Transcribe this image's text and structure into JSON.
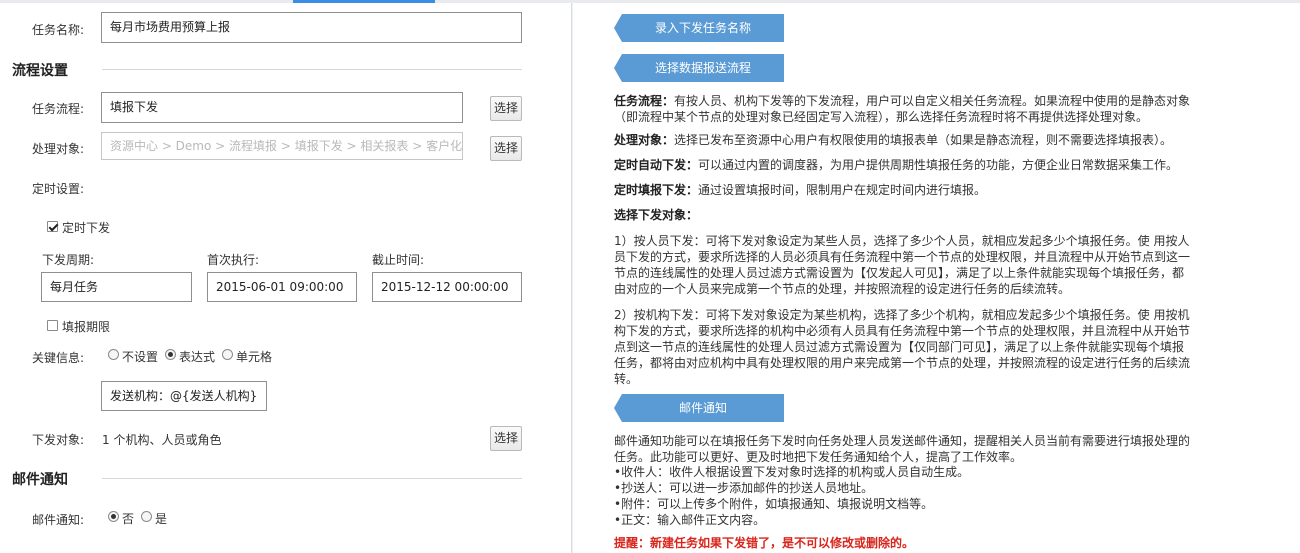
{
  "form": {
    "task_name_label": "任务名称:",
    "task_name_value": "每月市场费用预算上报",
    "section_flow": "流程设置",
    "flow_label": "任务流程:",
    "flow_value": "填报下发",
    "select_label": "选择",
    "target_label": "处理对象:",
    "target_value": "资源中心 > Demo > 流程填报 > 填报下发 > 相关报表 > 客户化de",
    "timer_label": "定时设置:",
    "timer_checkbox": "定时下发",
    "timer_checked": true,
    "period_label": "下发周期:",
    "period_value": "每月任务",
    "first_label": "首次执行:",
    "first_value": "2015-06-01 09:00:00",
    "deadline_label": "截止时间:",
    "deadline_value": "2015-12-12 00:00:00",
    "limit_checkbox": "填报期限",
    "limit_checked": false,
    "key_label": "关键信息:",
    "key_options": [
      "不设置",
      "表达式",
      "单元格"
    ],
    "key_selected": 1,
    "key_expr": "发送机构：@{发送人机构}",
    "dispatch_label": "下发对象:",
    "dispatch_value": "1 个机构、人员或角色",
    "section_mail": "邮件通知",
    "mail_label": "邮件通知:",
    "mail_options": [
      "否",
      "是"
    ],
    "mail_selected": 0
  },
  "help": {
    "tag1": "录入下发任务名称",
    "tag2": "选择数据报送流程",
    "p1_title": "任务流程：",
    "p1_text": "有按人员、机构下发等的下发流程，用户可以自定义相关任务流程。如果流程中使用的是静态对象（即流程中某个节点的处理对象已经固定写入流程），那么选择任务流程时将不再提供选择处理对象。",
    "p2_title": "处理对象：",
    "p2_text": "选择已发布至资源中心用户有权限使用的填报表单（如果是静态流程，则不需要选择填报表）。",
    "p3_title": "定时自动下发：",
    "p3_text": "可以通过内置的调度器，为用户提供周期性填报任务的功能，方便企业日常数据采集工作。",
    "p4_title": "定时填报下发：",
    "p4_text": "通过设置填报时间，限制用户在规定时间内进行填报。",
    "p5_title": "选择下发对象：",
    "p6_text": "1）按人员下发：可将下发对象设定为某些人员，选择了多少个人员，就相应发起多少个填报任务。使 用按人员下发的方式，要求所选择的人员必须具有任务流程中第一个节点的处理权限，并且流程中从开始节点到这一节点的连线属性的处理人员过滤方式需设置为【仅发起人可见】，满足了以上条件就能实现每个填报任务，都由对应的一个人员来完成第一个节点的处理，并按照流程的设定进行任务的后续流转。",
    "p7_text": "2）按机构下发：可将下发对象设定为某些机构，选择了多少个机构，就相应发起多少个填报任务。使 用按机构下发的方式，要求所选择的机构中必须有人员具有任务流程中第一个节点的处理权限，并且流程中从开始节点到这一节点的连线属性的处理人员过滤方式需设置为【仅同部门可见】，满足了以上条件就能实现每个填报任务，都将由对应机构中具有处理权限的用户来完成第一个节点的处理，并按照流程的设定进行任务的后续流转。",
    "tag3": "邮件通知",
    "p8_text": "邮件通知功能可以在填报任务下发时向任务处理人员发送邮件通知，提醒相关人员当前有需要进行填报处理的任务。此功能可以更好、更及时地把下发任务通知给个人，提高了工作效率。",
    "bullets": [
      "•收件人：收件人根据设置下发对象时选择的机构或人员自动生成。",
      "•抄送人：可以进一步添加邮件的抄送人员地址。",
      "•附件：可以上传多个附件，如填报通知、填报说明文档等。",
      "•正文：输入邮件正文内容。"
    ],
    "warning": "提醒：新建任务如果下发错了，是不可以修改或删除的。"
  }
}
